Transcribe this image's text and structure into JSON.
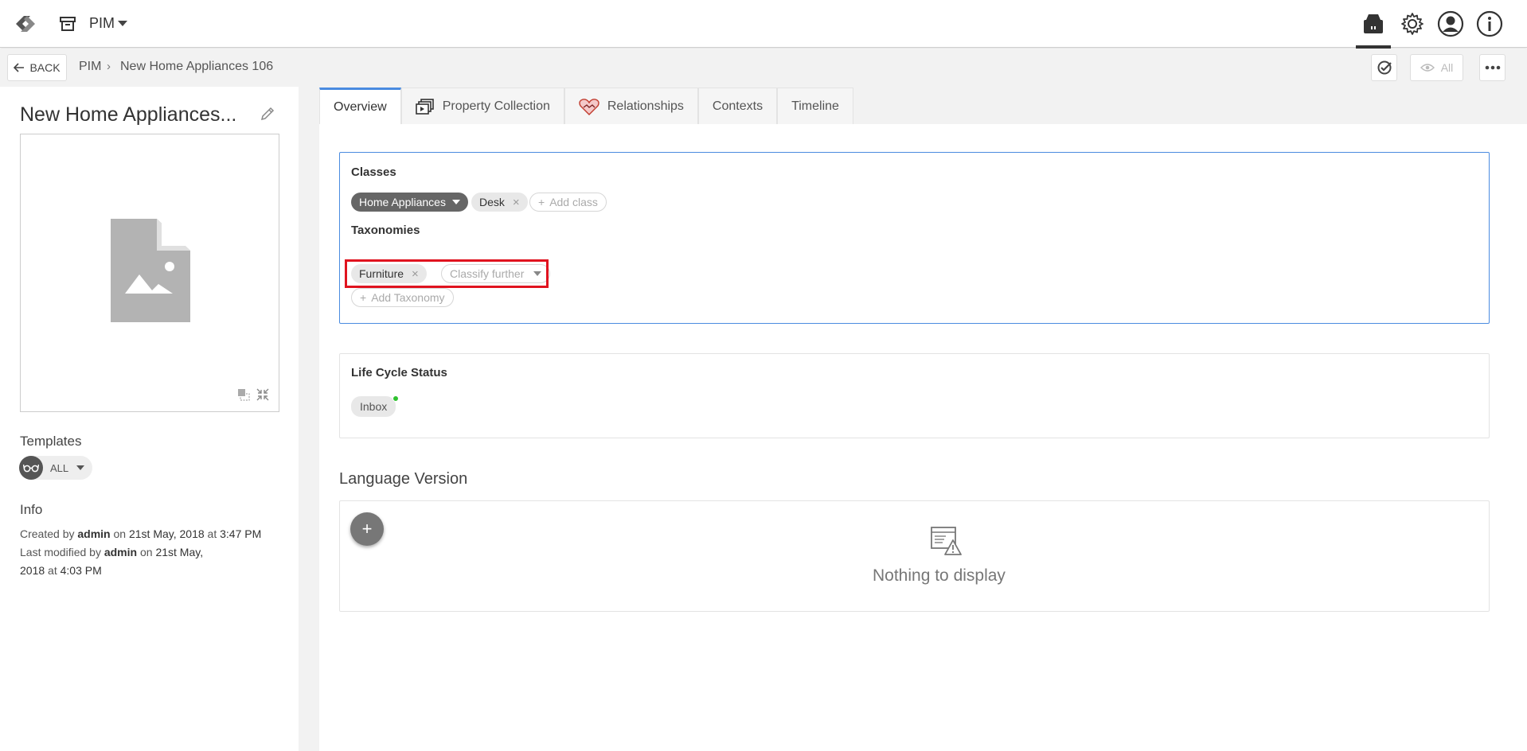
{
  "header": {
    "module": "PIM",
    "icons": [
      "logo-icon",
      "archive-icon",
      "inventory-icon",
      "gear-icon",
      "user-icon",
      "info-icon"
    ]
  },
  "subbar": {
    "back_label": "BACK",
    "breadcrumb": [
      "PIM",
      "New Home Appliances 106"
    ],
    "all_label": "All"
  },
  "entity": {
    "title": "New Home Appliances...",
    "templates_label": "Templates",
    "template_chip": "ALL",
    "info_label": "Info",
    "created_prefix": "Created by",
    "created_by": "admin",
    "created_on": "on",
    "created_date": "21st May, 2018",
    "created_at": "at",
    "created_time": "3:47 PM",
    "modified_prefix": "Last modified by",
    "modified_by": "admin",
    "modified_on": "on",
    "modified_date_1": "21st May,",
    "modified_date_2": "2018",
    "modified_at": "at",
    "modified_time": "4:03 PM"
  },
  "tabs": [
    {
      "label": "Overview"
    },
    {
      "label": "Property Collection"
    },
    {
      "label": "Relationships"
    },
    {
      "label": "Contexts"
    },
    {
      "label": "Timeline"
    }
  ],
  "classes": {
    "heading": "Classes",
    "primary": "Home Appliances",
    "secondary": "Desk",
    "add_label": "Add class"
  },
  "taxonomies": {
    "heading": "Taxonomies",
    "chip": "Furniture",
    "classify_label": "Classify further",
    "add_label": "Add Taxonomy"
  },
  "lifecycle": {
    "heading": "Life Cycle Status",
    "status": "Inbox",
    "status_color": "#2fc12f"
  },
  "language": {
    "heading": "Language Version",
    "empty_text": "Nothing to display"
  },
  "colors": {
    "accent": "#4a8be0",
    "highlight": "#e0131f"
  }
}
